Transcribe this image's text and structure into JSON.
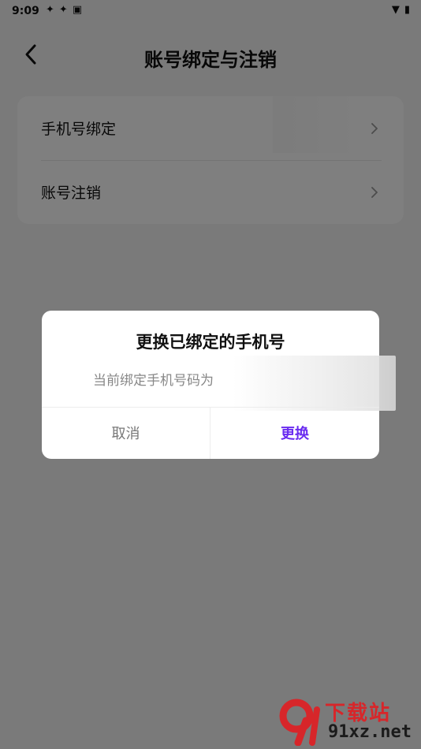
{
  "status_bar": {
    "time": "9:09",
    "left_icons": [
      "app-icon",
      "app-icon",
      "a-icon"
    ],
    "right_icons": [
      "wifi-icon",
      "battery-icon"
    ]
  },
  "nav": {
    "title": "账号绑定与注销"
  },
  "settings": {
    "items": [
      {
        "label": "手机号绑定"
      },
      {
        "label": "账号注销"
      }
    ]
  },
  "dialog": {
    "title": "更换已绑定的手机号",
    "message": "当前绑定手机号码为",
    "cancel_label": "取消",
    "confirm_label": "更换"
  },
  "watermark": {
    "top": "下载站",
    "bottom": "91xz.net"
  },
  "colors": {
    "accent": "#6a2cf0",
    "watermark_red": "#d7262a"
  }
}
